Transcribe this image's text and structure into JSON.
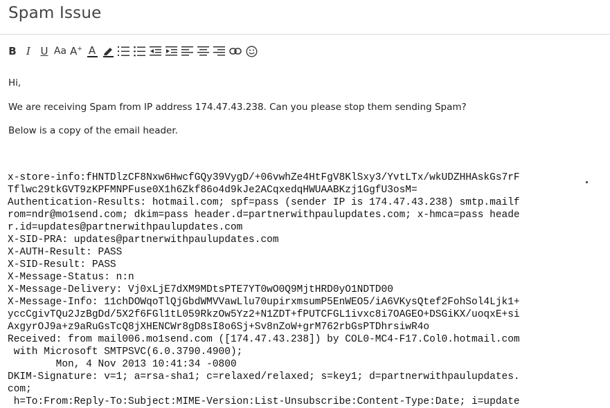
{
  "subject": "Spam Issue",
  "toolbar": {
    "items": [
      {
        "name": "bold",
        "label": "B"
      },
      {
        "name": "italic",
        "label": "I"
      },
      {
        "name": "underline",
        "label": "U"
      },
      {
        "name": "font-size",
        "label": "Aa"
      },
      {
        "name": "grow-font",
        "label": "A"
      },
      {
        "name": "font-color",
        "label": "A"
      },
      {
        "name": "highlight",
        "label": ""
      },
      {
        "name": "numbered-list",
        "label": ""
      },
      {
        "name": "bulleted-list",
        "label": ""
      },
      {
        "name": "decrease-indent",
        "label": ""
      },
      {
        "name": "increase-indent",
        "label": ""
      },
      {
        "name": "align-left",
        "label": ""
      },
      {
        "name": "align-center",
        "label": ""
      },
      {
        "name": "align-right",
        "label": ""
      },
      {
        "name": "insert-link",
        "label": ""
      },
      {
        "name": "emoji",
        "label": ""
      }
    ]
  },
  "message": {
    "greeting": "Hi,",
    "line1": "We are receiving Spam from IP address 174.47.43.238. Can you please stop them sending Spam?",
    "line2": "Below is a copy of the email header.",
    "header_lines": [
      "x-store-info:fHNTDlzCF8Nxw6HwcfGQy39VygD/+06vwhZe4HtFgV8KlSxy3/YvtLTx/wkUDZHHAskGs7rF",
      "Tflwc29tkGVT9zKPFMNPFuse0X1h6Zkf86o4d9kJe2ACqxedqHWUAABKzj1GgfU3osM=",
      "Authentication-Results: hotmail.com; spf=pass (sender IP is 174.47.43.238) smtp.mailf",
      "rom=ndr@mo1send.com; dkim=pass header.d=partnerwithpaulupdates.com; x-hmca=pass heade",
      "r.id=updates@partnerwithpaulupdates.com",
      "X-SID-PRA: updates@partnerwithpaulupdates.com",
      "X-AUTH-Result: PASS",
      "X-SID-Result: PASS",
      "X-Message-Status: n:n",
      "X-Message-Delivery: Vj0xLjE7dXM9MDtsPTE7YT0wO0Q9MjtHRD0yO1NDTD00",
      "X-Message-Info: 11chDOWqoTlQjGbdWMVVawLlu70upirxmsumP5EnWEO5/iA6VKysQtef2FohSol4Ljk1+",
      "yccCgivTQu2JzBgDd/5X2f6FGl1tL059RkzOw5Yz2+N1ZDT+fPUTCFGL1ivxc8i7OAGEO+DSGiKX/uoqxE+si",
      "AxgyrOJ9a+z9aRuGsTcQ8jXHENCWr8gD8sI8o6Sj+Sv8nZoW+grM762rbGsPTDhrsiwR4o",
      "Received: from mail006.mo1send.com ([174.47.43.238]) by COL0-MC4-F17.Col0.hotmail.com",
      " with Microsoft SMTPSVC(6.0.3790.4900);",
      "        Mon, 4 Nov 2013 10:41:34 -0800",
      "DKIM-Signature: v=1; a=rsa-sha1; c=relaxed/relaxed; s=key1; d=partnerwithpaulupdates.",
      "com;",
      " h=To:From:Reply-To:Subject:MIME-Version:List-Unsubscribe:Content-Type:Date; i=update"
    ]
  }
}
